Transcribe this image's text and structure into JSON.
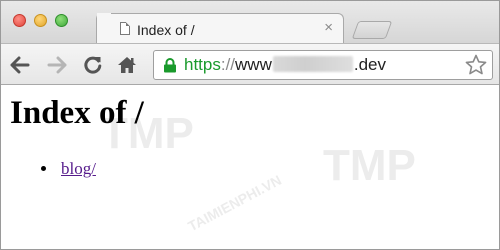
{
  "browser": {
    "tab": {
      "title": "Index of /",
      "close_glyph": "×"
    },
    "toolbar": {
      "url_scheme": "https",
      "url_separator": "://",
      "url_prefix": "www",
      "url_suffix": ".dev"
    },
    "icons": {
      "back": "back-arrow-icon",
      "forward": "forward-arrow-icon",
      "reload": "reload-icon",
      "home": "home-icon",
      "lock": "lock-icon",
      "bookmark": "star-icon"
    },
    "colors": {
      "secure_green": "#1a9a2c",
      "visited_link": "#551a8b"
    }
  },
  "page": {
    "heading": "Index of /",
    "entries": [
      {
        "label": "blog/"
      }
    ]
  },
  "watermark": {
    "text_1": "TMP",
    "text_2": "TMP",
    "text_3": "TAIMIENPHI.VN"
  }
}
